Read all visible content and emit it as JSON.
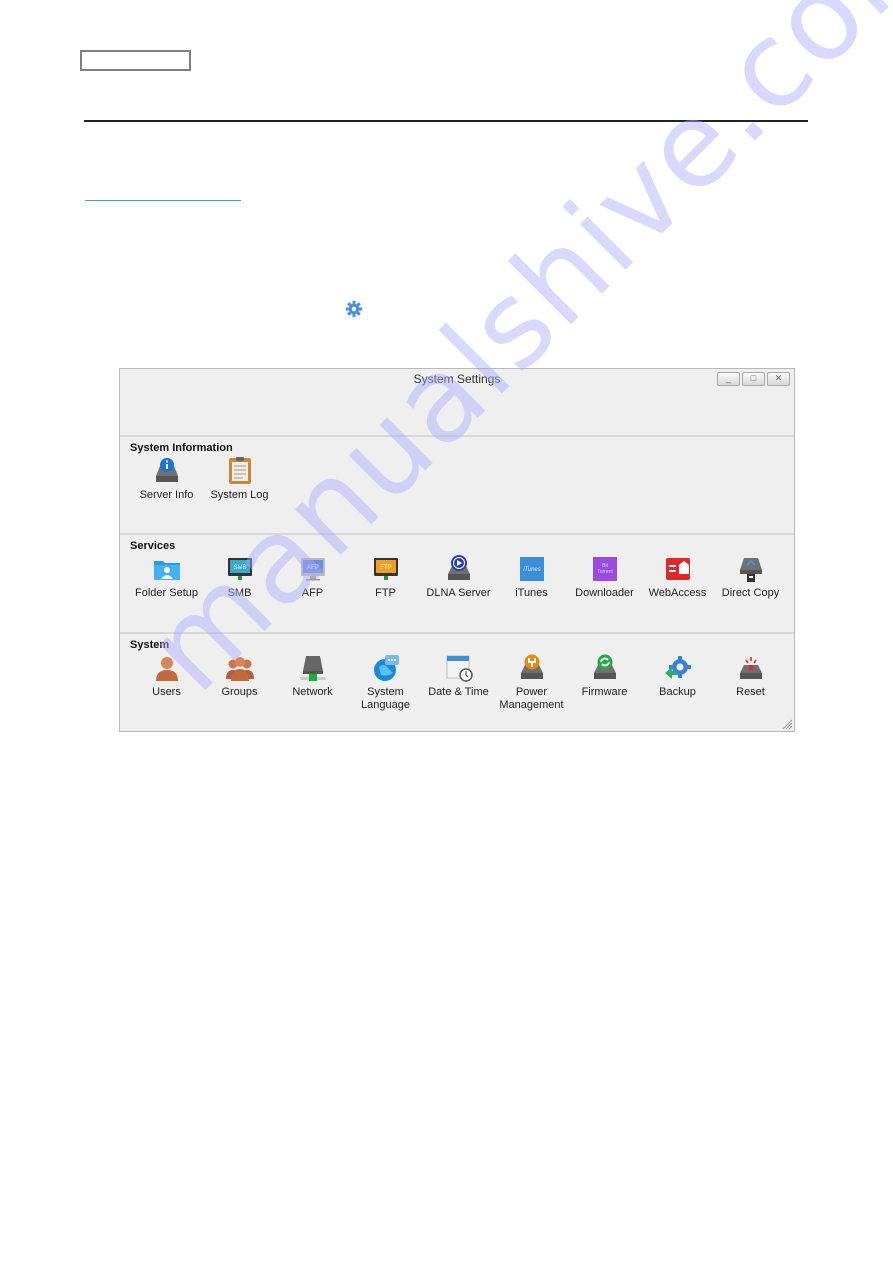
{
  "page": {
    "watermark": "manualshive.com"
  },
  "window": {
    "title": "System Settings",
    "buttons": {
      "minimize": "_",
      "maximize": "□",
      "close": "✕"
    }
  },
  "sections": [
    {
      "title": "System Information",
      "items": [
        {
          "label": "Server Info",
          "icon": "server-info-icon"
        },
        {
          "label": "System Log",
          "icon": "system-log-icon"
        }
      ]
    },
    {
      "title": "Services",
      "items": [
        {
          "label": "Folder Setup",
          "icon": "folder-setup-icon"
        },
        {
          "label": "SMB",
          "icon": "smb-icon",
          "badge": "SMB"
        },
        {
          "label": "AFP",
          "icon": "afp-icon",
          "badge": "AFP"
        },
        {
          "label": "FTP",
          "icon": "ftp-icon",
          "badge": "FTP"
        },
        {
          "label": "DLNA Server",
          "icon": "dlna-server-icon"
        },
        {
          "label": "iTunes",
          "icon": "itunes-icon",
          "badge": "iTunes"
        },
        {
          "label": "Downloader",
          "icon": "downloader-icon",
          "badge": "Bit Torrent"
        },
        {
          "label": "WebAccess",
          "icon": "webaccess-icon"
        },
        {
          "label": "Direct Copy",
          "icon": "direct-copy-icon"
        }
      ]
    },
    {
      "title": "System",
      "items": [
        {
          "label": "Users",
          "icon": "users-icon"
        },
        {
          "label": "Groups",
          "icon": "groups-icon"
        },
        {
          "label": "Network",
          "icon": "network-icon"
        },
        {
          "label": "System Language",
          "label_line1": "System",
          "label_line2": "Language",
          "icon": "system-language-icon"
        },
        {
          "label": "Date & Time",
          "icon": "date-time-icon"
        },
        {
          "label": "Power Management",
          "label_line1": "Power",
          "label_line2": "Management",
          "icon": "power-management-icon"
        },
        {
          "label": "Firmware",
          "icon": "firmware-icon"
        },
        {
          "label": "Backup",
          "icon": "backup-icon"
        },
        {
          "label": "Reset",
          "icon": "reset-icon"
        }
      ]
    }
  ],
  "colors": {
    "link": "#2aa6d8",
    "gear": "#4a8fd8",
    "window_bg": "#efefef"
  }
}
